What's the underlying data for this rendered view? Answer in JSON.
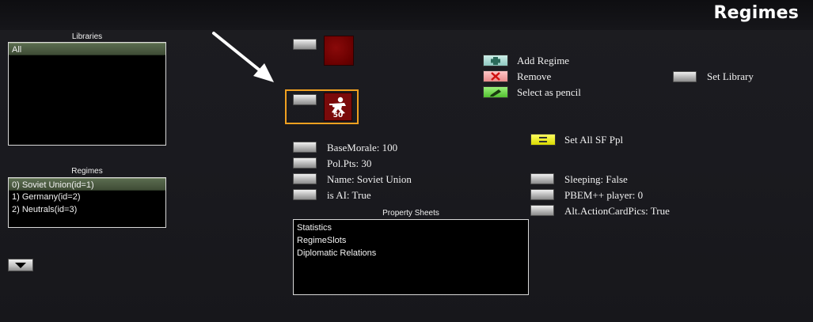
{
  "header": {
    "title": "Regimes"
  },
  "libraries": {
    "label": "Libraries",
    "items": [
      "All"
    ]
  },
  "regimes": {
    "label": "Regimes",
    "items": [
      "0) Soviet Union(id=1)",
      "1) Germany(id=2)",
      "2) Neutrals(id=3)"
    ]
  },
  "unit_icon": {
    "value": "50"
  },
  "actions": {
    "add": "Add Regime",
    "remove": "Remove",
    "pencil": "Select as pencil",
    "set_library": "Set Library",
    "set_sf": "Set All SF Ppl"
  },
  "properties": {
    "base_morale": "BaseMorale:  100",
    "pol_pts": "Pol.Pts:  30",
    "name": "Name: Soviet Union",
    "is_ai": "is AI: True",
    "sleeping": "Sleeping: False",
    "pbem": "PBEM++ player:  0",
    "alt_cards": "Alt.ActionCardPics: True"
  },
  "property_sheets": {
    "label": "Property Sheets",
    "items": [
      "Statistics",
      "RegimeSlots",
      "Diplomatic Relations"
    ]
  },
  "colors": {
    "regime_color": "#7a0000",
    "highlight": "#f0a020",
    "add_btn": "#a8d8d0",
    "remove_btn": "#f0a0a0",
    "pencil_btn": "#70e050",
    "set_sf_btn": "#f0f020"
  }
}
